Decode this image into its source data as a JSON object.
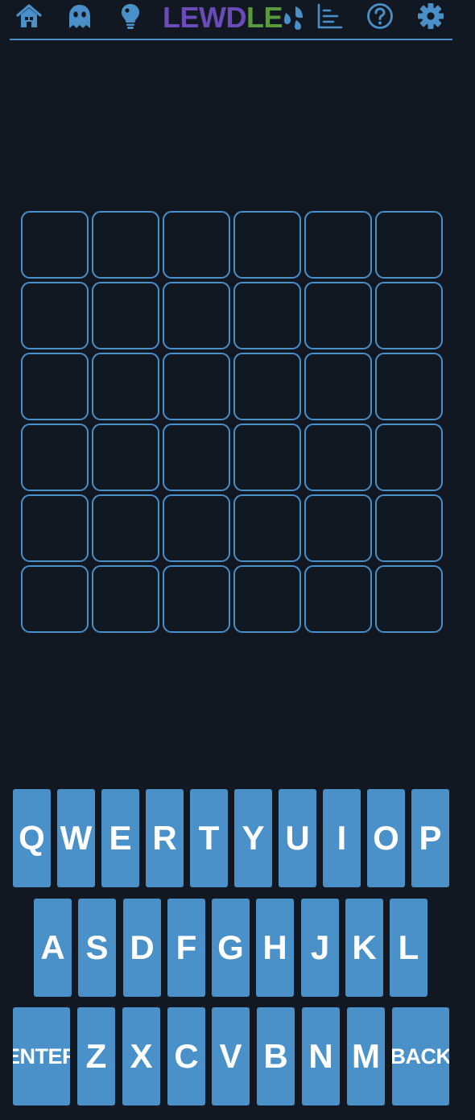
{
  "nav": {
    "logo_part1": "LEWD",
    "logo_part2": "LE",
    "icons": [
      "home-icon",
      "ghost-icon",
      "lightbulb-icon",
      "stats-icon",
      "help-icon",
      "settings-icon"
    ]
  },
  "colors": {
    "background": "#111822",
    "accent": "#4a8fc7",
    "key": "#4b91c9",
    "logo_purple": "#6a4bb8",
    "logo_green": "#5a9a3e"
  },
  "board": {
    "rows": 6,
    "cols": 6,
    "letters": [
      [
        "",
        "",
        "",
        "",
        "",
        ""
      ],
      [
        "",
        "",
        "",
        "",
        "",
        ""
      ],
      [
        "",
        "",
        "",
        "",
        "",
        ""
      ],
      [
        "",
        "",
        "",
        "",
        "",
        ""
      ],
      [
        "",
        "",
        "",
        "",
        "",
        ""
      ],
      [
        "",
        "",
        "",
        "",
        "",
        ""
      ]
    ]
  },
  "keyboard": {
    "row1": [
      "Q",
      "W",
      "E",
      "R",
      "T",
      "Y",
      "U",
      "I",
      "O",
      "P"
    ],
    "row2": [
      "A",
      "S",
      "D",
      "F",
      "G",
      "H",
      "J",
      "K",
      "L"
    ],
    "row3": [
      "ENTER",
      "Z",
      "X",
      "C",
      "V",
      "B",
      "N",
      "M",
      "BACK"
    ]
  }
}
